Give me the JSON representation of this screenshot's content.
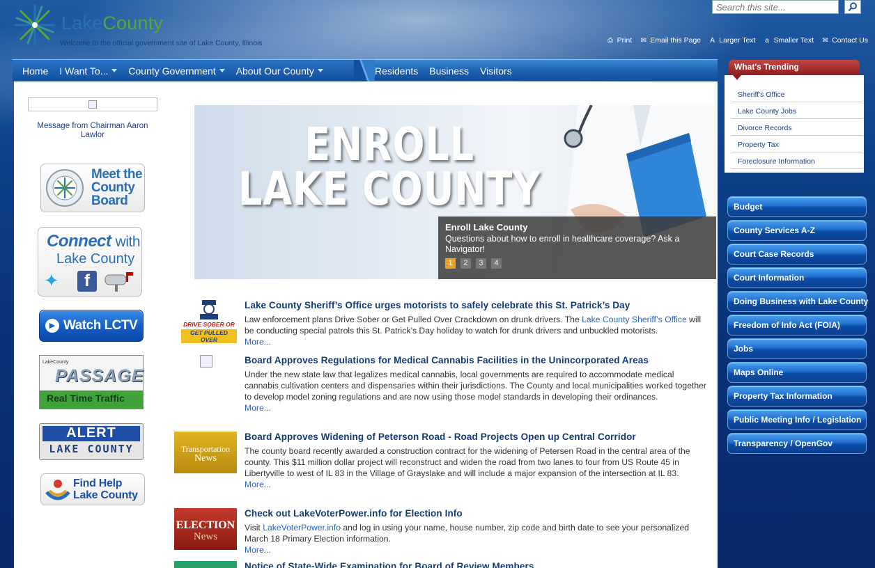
{
  "header": {
    "logo_name_part1": "Lake",
    "logo_name_part2": "County",
    "tagline": "Welcome to the official government site of Lake County, Illinois",
    "search_placeholder": "Search this site...",
    "utilities": [
      {
        "label": "Print",
        "icon": "printer-icon"
      },
      {
        "label": "Email this Page",
        "icon": "email-icon"
      },
      {
        "label": "Larger Text",
        "icon": "larger-text-icon"
      },
      {
        "label": "Smaller Text",
        "icon": "smaller-text-icon"
      },
      {
        "label": "Contact Us",
        "icon": "envelope-icon"
      }
    ]
  },
  "nav": {
    "left": [
      {
        "label": "Home",
        "dropdown": false
      },
      {
        "label": "I Want To...",
        "dropdown": true
      },
      {
        "label": "County Government",
        "dropdown": true
      },
      {
        "label": "About Our County",
        "dropdown": true
      }
    ],
    "right": [
      "Residents",
      "Business",
      "Visitors"
    ]
  },
  "left_column": {
    "chairman_text": "Message from Chairman Aaron Lawlor",
    "badges": {
      "board": {
        "l1": "Meet the",
        "l2": "County",
        "l3": "Board"
      },
      "connect": {
        "l1": "Connect",
        "l1b": "with",
        "l2": "Lake County"
      },
      "lctv": "Watch LCTV",
      "passage": {
        "small": "LakeCounty",
        "big": "PASSAGE",
        "sub": "Real Time Traffic"
      },
      "alert": {
        "l1": "ALERT",
        "l2": "LAKE COUNTY"
      },
      "findhelp": {
        "l1": "Find Help",
        "l2": "Lake County"
      }
    }
  },
  "hero": {
    "line1": "ENROLL",
    "line2": "LAKE COUNTY",
    "caption_title": "Enroll Lake County",
    "caption_text": "Questions about how to enroll in healthcare coverage? Ask a Navigator!",
    "pages": [
      "1",
      "2",
      "3",
      "4"
    ],
    "active_page": "1"
  },
  "news": [
    {
      "title": "Lake County Sheriff’s Office urges motorists to safely celebrate this St. Patrick’s Day",
      "text_before_link": "Law enforcement plans Drive Sober or Get Pulled Over Crackdown on drunk drivers. The ",
      "link": "Lake County Sheriff’s Office",
      "text_after_link": " will be conducting special patrols this St. Patrick’s Day holiday to watch for drunk drivers and unbuckled motorists.",
      "more": "More...",
      "thumb_line1": "DRIVE SOBER OR",
      "thumb_line2": "GET PULLED OVER"
    },
    {
      "title": "Board Approves Regulations for Medical Cannabis Facilities in the Unincorporated Areas",
      "text": "Under the new state law that legalizes medical cannabis, local governments are required to accommodate medical cannabis cultivation centers and dispensaries within their jurisdictions. The County and local municipalities worked together to develop model zoning regulations and are now using those model standards in developing their ordinances.",
      "more": "More..."
    },
    {
      "title": "Board Approves Widening of Peterson Road - Road Projects Open up Central Corridor",
      "text": "The county board recently awarded a construction contract for the widening of Petersen Road in the central area of the county. This $11 million dollar project will reconstruct and widen the road from two lanes to four from US Route 45 in Libertyville to west of IL 83 in the Village of Grayslake and will include a major expansion of the intersection at IL 83.",
      "more": "More...",
      "thumb_line1": "Transportation",
      "thumb_line2": "News"
    },
    {
      "title": "Check out LakeVoterPower.info for Election Info",
      "text_before_link": "Visit ",
      "link": "LakeVoterPower.info",
      "text_after_link": " and log in using your name, house number, zip code and birth date to see your personalized March 18 Primary Election information.",
      "more": "More...",
      "thumb_line1": "ELECTION",
      "thumb_line2": "News"
    },
    {
      "title": "Notice of State-Wide Examination for Board of Review Members"
    }
  ],
  "trending": {
    "title": "What's Trending",
    "items": [
      "Sheriff's Office",
      "Lake County Jobs",
      "Divorce Records",
      "Property Tax",
      "Foreclosure Information"
    ]
  },
  "quick_links": [
    "Budget",
    "County Services A-Z",
    "Court Case Records",
    "Court Information",
    "Doing Business with Lake County",
    "Freedom of Info Act (FOIA)",
    "Jobs",
    "Maps Online",
    "Property Tax Information",
    "Public Meeting Info / Legislation",
    "Transparency / OpenGov"
  ],
  "colors": {
    "brand_blue": "#2a6fb5",
    "brand_green": "#5aa53a",
    "trending_red": "#8c1f1f",
    "active_dot": "#f0a020",
    "news_title": "#123a78"
  }
}
